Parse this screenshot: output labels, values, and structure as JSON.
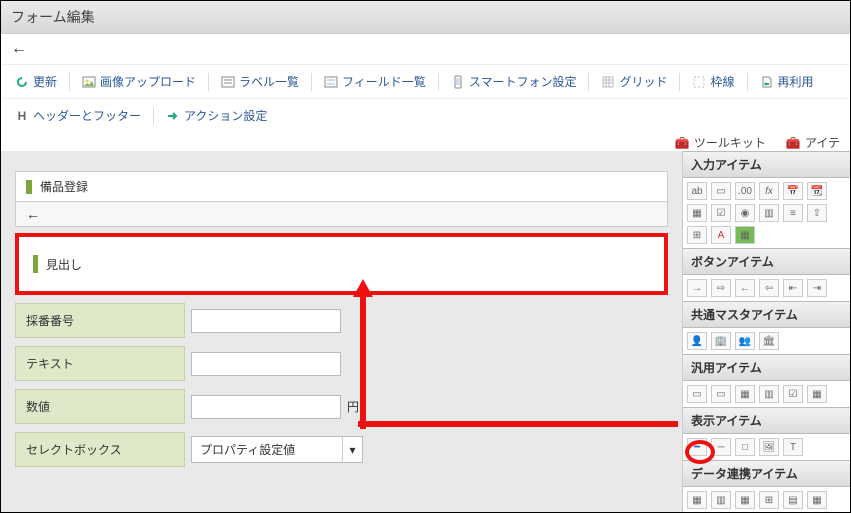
{
  "title": "フォーム編集",
  "toolbar": {
    "refresh": "更新",
    "imgupload": "画像アップロード",
    "labellist": "ラベル一覧",
    "fieldlist": "フィールド一覧",
    "smartphone": "スマートフォン設定",
    "grid": "グリッド",
    "frame": "枠線",
    "reuse": "再利用",
    "headerfooter": "ヘッダーとフッター",
    "action": "アクション設定"
  },
  "tabs": {
    "toolkit": "ツールキット",
    "item": "アイテ"
  },
  "form": {
    "name": "備品登録",
    "headline": "見出し",
    "fields": {
      "seq": {
        "label": "採番番号"
      },
      "text": {
        "label": "テキスト"
      },
      "num": {
        "label": "数値",
        "suffix": "円"
      },
      "select": {
        "label": "セレクトボックス",
        "value": "プロパティ設定値"
      }
    }
  },
  "side": {
    "input": "入力アイテム",
    "button": "ボタンアイテム",
    "master": "共通マスタアイテム",
    "generic": "汎用アイテム",
    "display": "表示アイテム",
    "link": "データ連携アイテム"
  }
}
